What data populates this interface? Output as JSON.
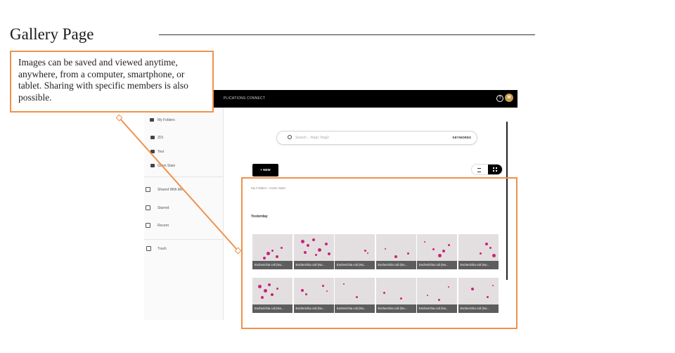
{
  "page": {
    "title": "Gallery Page",
    "callout_text": "Images can be saved and viewed anytime, anywhere, from a computer, smartphone, or tablet. Sharing with specific members is also possible."
  },
  "colors": {
    "accent": "#f0914a",
    "topbar": "#000000",
    "avatar": "#c79a46",
    "stain": "#c8237a"
  },
  "app": {
    "topbar": {
      "nav_text": "PLICATIONS   CONNECT",
      "avatar_initial": "M",
      "help_icon": "question-circle-icon"
    },
    "sidebar": {
      "my_folders": "My Folders",
      "folders": [
        "ZDI",
        "Test",
        "Gram Stain"
      ],
      "shared": "Shared With Me",
      "starred": "Starred",
      "recent": "Recent",
      "trash": "Trash"
    },
    "search": {
      "placeholder": "Search... #tag1 #tag2",
      "keywords_label": "KEYWORDS"
    },
    "new_button": "+ NEW",
    "breadcrumb": "My Folders  ›  Gram Stain",
    "section": "Yesterday",
    "thumbnails": [
      {
        "caption": "Escherichia coli (No..."
      },
      {
        "caption": "Escherichia coli (No..."
      },
      {
        "caption": "Escherichia coli (No..."
      },
      {
        "caption": "Escherichia coli (No..."
      },
      {
        "caption": "Escherichia coli (No..."
      },
      {
        "caption": "Escherichia coli (No..."
      },
      {
        "caption": "Escherichia coli (No..."
      },
      {
        "caption": "Escherichia coli (No..."
      },
      {
        "caption": "Escherichia coli (No..."
      },
      {
        "caption": "Escherichia coli (No..."
      },
      {
        "caption": "Escherichia coli (No..."
      },
      {
        "caption": "Escherichia coli (No..."
      }
    ]
  }
}
